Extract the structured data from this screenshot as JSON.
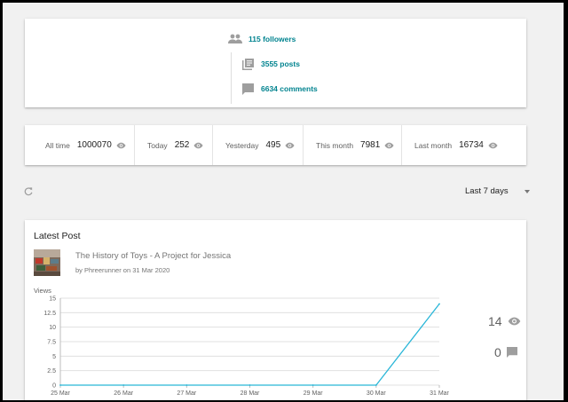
{
  "overview": {
    "followers": "115 followers",
    "posts": "3555 posts",
    "comments": "6634 comments"
  },
  "stats": [
    {
      "label": "All time",
      "value": "1000070"
    },
    {
      "label": "Today",
      "value": "252"
    },
    {
      "label": "Yesterday",
      "value": "495"
    },
    {
      "label": "This month",
      "value": "7981"
    },
    {
      "label": "Last month",
      "value": "16734"
    }
  ],
  "range": {
    "selected": "Last 7 days"
  },
  "latest": {
    "heading": "Latest Post",
    "post_title": "The History of Toys - A Project for Jessica",
    "post_meta": "by Phreerunner on 31 Mar 2020",
    "views_total": "14",
    "comments_total": "0"
  },
  "colors": {
    "accent": "#00838f",
    "line": "#29b6d8"
  },
  "chart_data": {
    "type": "line",
    "ylabel": "Views",
    "categories": [
      "25 Mar",
      "26 Mar",
      "27 Mar",
      "28 Mar",
      "29 Mar",
      "30 Mar",
      "31 Mar"
    ],
    "values": [
      0,
      0,
      0,
      0,
      0,
      0,
      14
    ],
    "ylim": [
      0,
      15
    ],
    "yticks": [
      0,
      2.5,
      5,
      7.5,
      10,
      12.5,
      15
    ],
    "grid": true
  }
}
